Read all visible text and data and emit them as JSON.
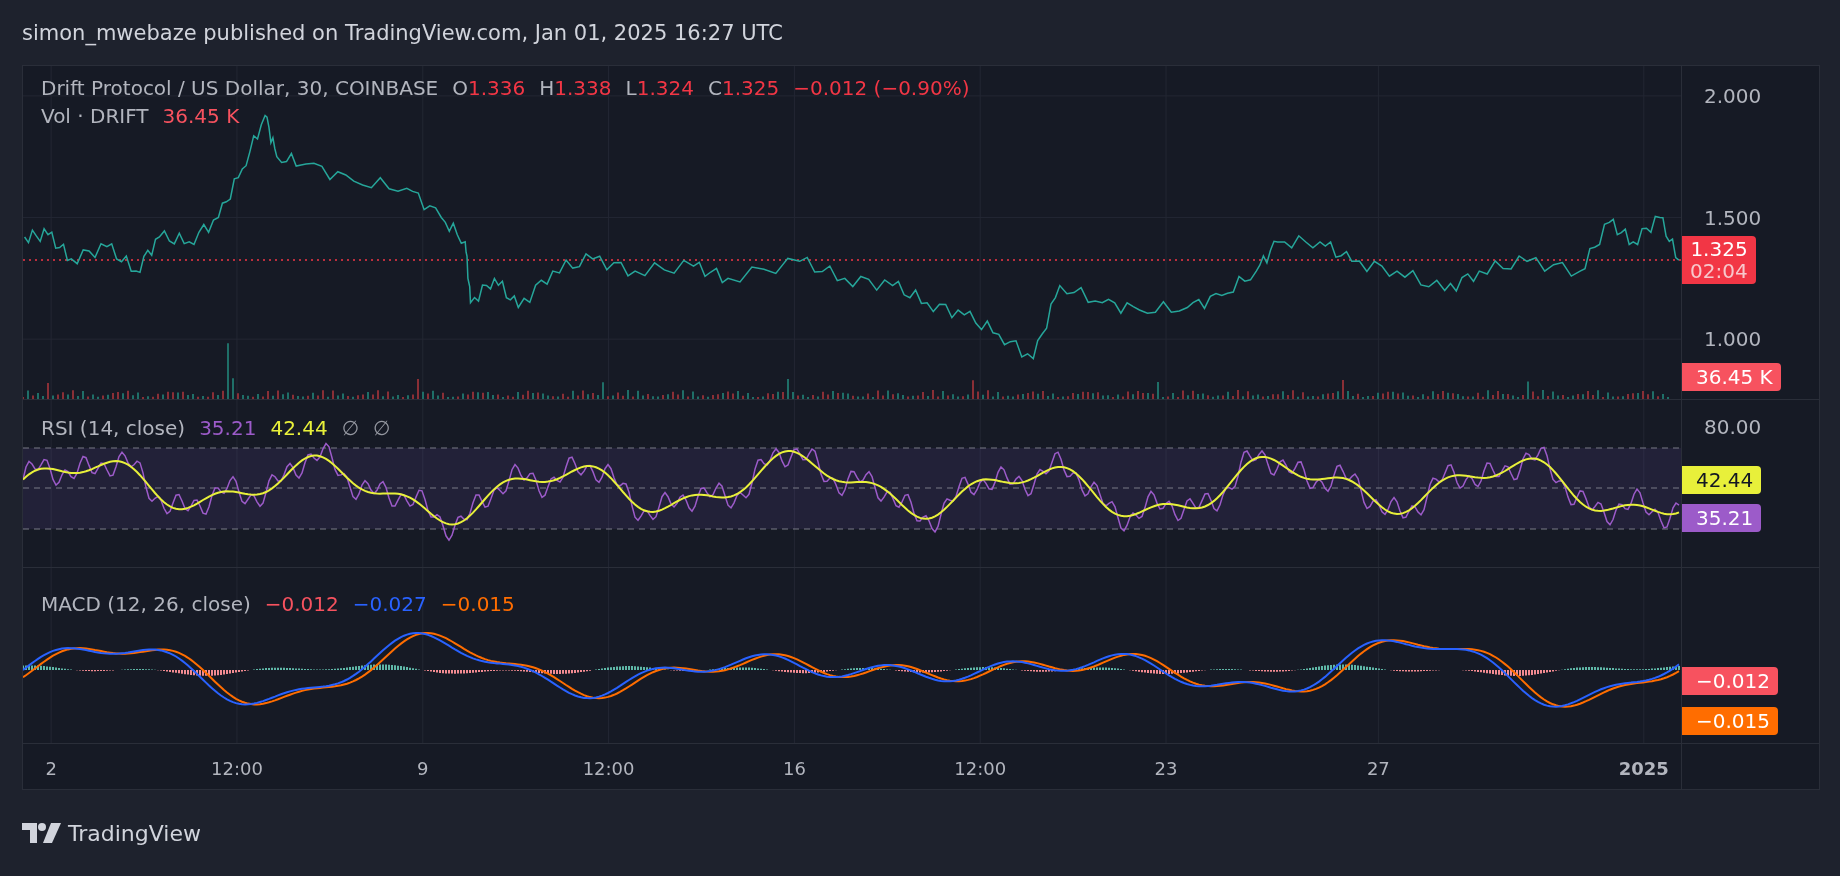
{
  "header": {
    "title": "simon_mwebaze published on TradingView.com, Jan 01, 2025 16:27 UTC"
  },
  "price_pane": {
    "legend": {
      "symbol": "Drift Protocol / US Dollar, 30, COINBASE",
      "ohlc": [
        {
          "label": "O",
          "value": "1.336"
        },
        {
          "label": "H",
          "value": "1.338"
        },
        {
          "label": "L",
          "value": "1.324"
        },
        {
          "label": "C",
          "value": "1.325"
        }
      ],
      "change": "−0.012 (−0.90%)"
    },
    "volume_legend": {
      "label": "Vol · DRIFT",
      "value": "36.45 K"
    },
    "last_price": {
      "price": "1.325",
      "countdown": "02:04"
    },
    "volume_badge": "36.45 K",
    "axis_labels": [
      "2.000",
      "1.500",
      "1.000"
    ]
  },
  "time_axis": [
    {
      "label": "2",
      "bold": false
    },
    {
      "label": "12:00",
      "bold": false
    },
    {
      "label": "9",
      "bold": false
    },
    {
      "label": "12:00",
      "bold": false
    },
    {
      "label": "16",
      "bold": false
    },
    {
      "label": "12:00",
      "bold": false
    },
    {
      "label": "23",
      "bold": false
    },
    {
      "label": "27",
      "bold": false
    },
    {
      "label": "2025",
      "bold": true
    }
  ],
  "rsi_pane": {
    "legend": {
      "name": "RSI (14, close)",
      "values": [
        {
          "text": "35.21",
          "color": "#9c5bc9"
        },
        {
          "text": "42.44",
          "color": "#e8f03a"
        },
        {
          "text": "∅",
          "color": "#9598a1"
        },
        {
          "text": "∅",
          "color": "#9598a1"
        }
      ]
    },
    "axis_label": "80.00",
    "badges": [
      {
        "text": "42.44",
        "color": "#e8f03a"
      },
      {
        "text": "35.21",
        "color": "#9c5bc9"
      }
    ]
  },
  "macd_pane": {
    "legend": {
      "name": "MACD (12, 26, close)",
      "values": [
        {
          "text": "−0.012",
          "color": "#f7525f"
        },
        {
          "text": "−0.027",
          "color": "#2962ff"
        },
        {
          "text": "−0.015",
          "color": "#ff6d00"
        }
      ]
    },
    "badges": [
      {
        "text": "−0.012",
        "color": "#f7525f"
      },
      {
        "text": "−0.015",
        "color": "#ff6d00"
      }
    ]
  },
  "footer": {
    "brand": "TradingView"
  }
}
